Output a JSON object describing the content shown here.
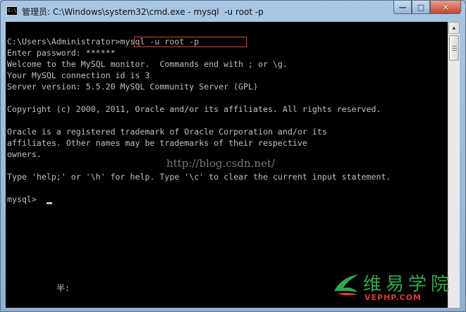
{
  "window": {
    "title": "管理员: C:\\Windows\\system32\\cmd.exe - mysql  -u root -p",
    "icon": "cmd-icon",
    "icon_glyph": "C:\\",
    "buttons": {
      "minimize_glyph": "—",
      "maximize_glyph": "□",
      "close_glyph": "✕"
    }
  },
  "console": {
    "prompt": "C:\\Users\\Administrator>",
    "command": "mysql -u root -p",
    "lines": [
      "Enter password: ******",
      "Welcome to the MySQL monitor.  Commands end with ; or \\g.",
      "Your MySQL connection id is 3",
      "Server version: 5.5.20 MySQL Community Server (GPL)",
      "",
      "Copyright (c) 2000, 2011, Oracle and/or its affiliates. All rights reserved.",
      "",
      "Oracle is a registered trademark of Oracle Corporation and/or its",
      "affiliates. Other names may be trademarks of their respective",
      "owners.",
      "",
      "Type 'help;' or '\\h' for help. Type '\\c' to clear the current input statement.",
      "",
      "mysql> "
    ],
    "ime_status": "半:"
  },
  "watermarks": {
    "url_text": "http://blog.csdn.net/",
    "logo_cn": "维易学院",
    "logo_en": "VEPHP.COM"
  },
  "scrollbar": {
    "up_arrow": "▲"
  },
  "colors": {
    "console_bg": "#000000",
    "console_fg": "#c0c0c0",
    "highlight_box": "#e0452c",
    "logo_green": "#2fa84f",
    "logo_red": "#e23a2e",
    "close_button": "#c7462b"
  }
}
